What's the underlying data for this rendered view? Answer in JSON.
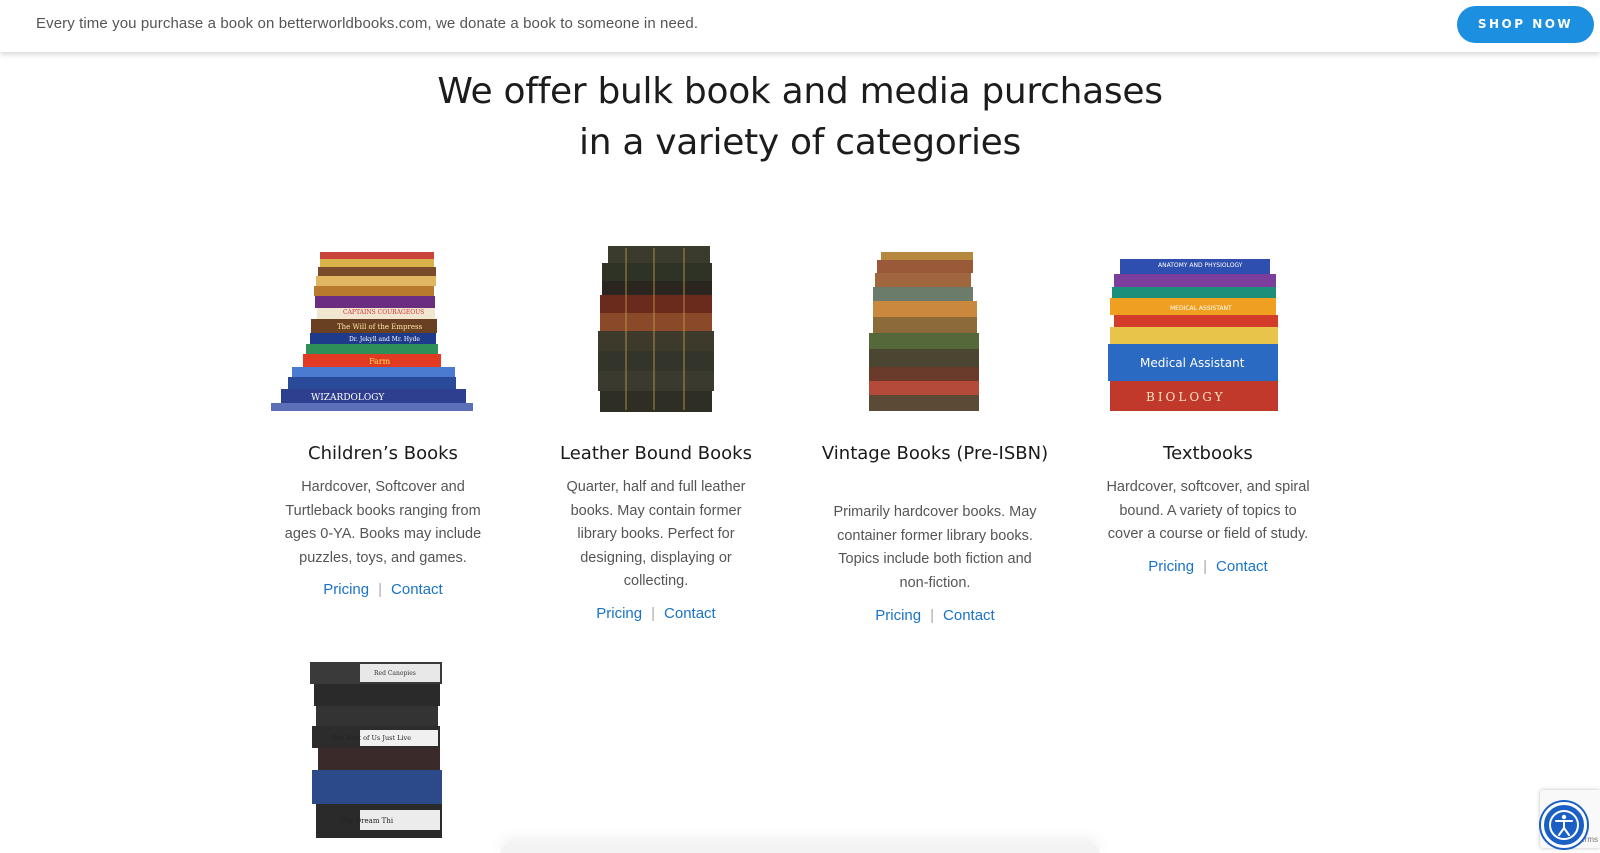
{
  "topbar": {
    "message": "Every time you purchase a book on betterworldbooks.com, we donate a book to someone in need.",
    "shop_button": "SHOP NOW"
  },
  "heading": {
    "line1": "We offer bulk book and media purchases",
    "line2": "in a variety of categories"
  },
  "categories": [
    {
      "title": "Children’s Books",
      "description": "Hardcover, Softcover and Turtleback books ranging from ages 0-YA. Books may include puzzles, toys, and games.",
      "pricing": "Pricing",
      "separator": "|",
      "contact": "Contact",
      "image": "childrens-book-stack-image"
    },
    {
      "title": "Leather Bound Books",
      "description": "Quarter, half and full leather books. May contain former library books. Perfect for designing, displaying or collecting.",
      "pricing": "Pricing",
      "separator": "|",
      "contact": "Contact",
      "image": "leather-book-stack-image"
    },
    {
      "title": "Vintage Books (Pre-ISBN)",
      "description": "Primarily hardcover books.  May container former library books. Topics include both fiction and non-fiction.",
      "pricing": "Pricing",
      "separator": "|",
      "contact": "Contact",
      "image": "vintage-book-stack-image"
    },
    {
      "title": "Textbooks",
      "description": "Hardcover, softcover, and spiral bound. A variety of topics to cover a course or field of study.",
      "pricing": "Pricing",
      "separator": "|",
      "contact": "Contact",
      "image": "textbook-stack-image"
    }
  ],
  "fifth_item": {
    "image": "vhs-tape-stack-image",
    "spines": [
      "Red Canopies",
      "",
      "",
      "The Best of Us Just Live",
      "",
      "",
      "The Dream Thi"
    ]
  },
  "widgets": {
    "recaptcha_terms": "Terms",
    "accessibility_icon": "accessibility-icon"
  },
  "colors": {
    "accent": "#1d8fe0",
    "link": "#1a73c7"
  }
}
